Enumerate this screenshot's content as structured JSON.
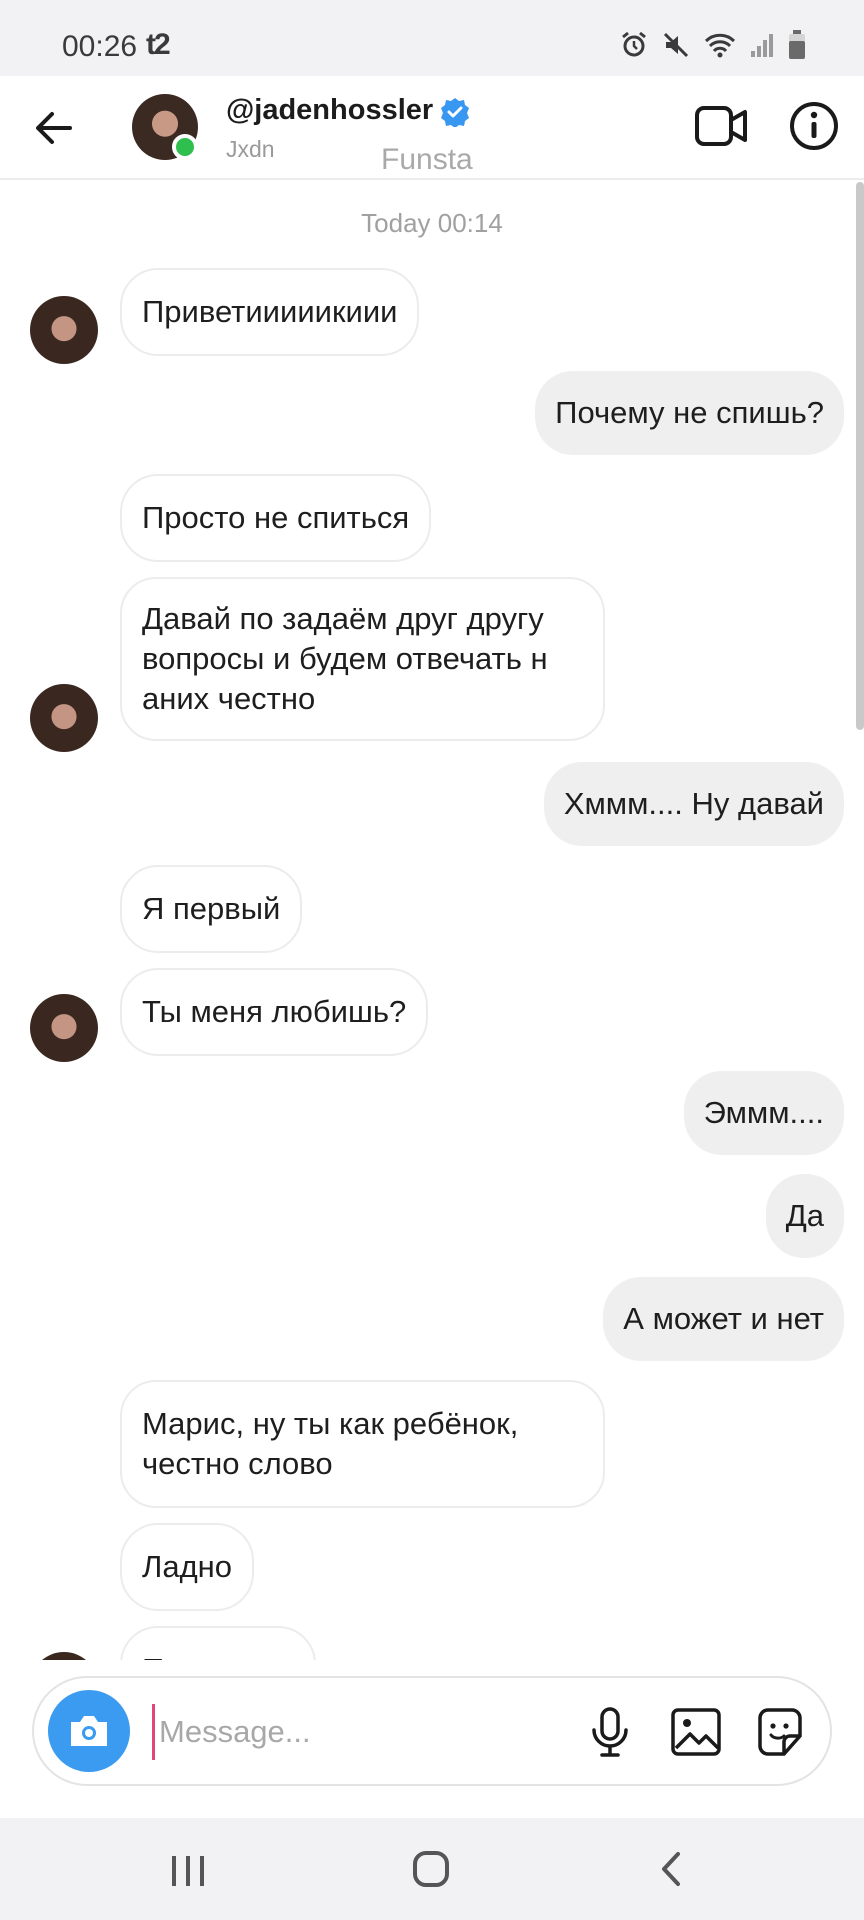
{
  "status_bar": {
    "time": "00:26",
    "carrier": "t2"
  },
  "header": {
    "username": "@jadenhossler",
    "subname": "Jxdn",
    "overlay_text": "Funsta"
  },
  "chat": {
    "timestamp": "Today 00:14",
    "messages": [
      {
        "dir": "in",
        "text": "Приветииииикиии"
      },
      {
        "dir": "out",
        "text": "Почему не спишь?"
      },
      {
        "dir": "in",
        "text": "Просто не спиться"
      },
      {
        "dir": "in",
        "text": "Давай по задаём друг другу вопросы и будем отвечать н аних честно"
      },
      {
        "dir": "out",
        "text": "Хммм.... Ну давай"
      },
      {
        "dir": "in",
        "text": "Я первый"
      },
      {
        "dir": "in",
        "text": "Ты меня любишь?"
      },
      {
        "dir": "out",
        "text": "Эммм...."
      },
      {
        "dir": "out",
        "text": "Да"
      },
      {
        "dir": "out",
        "text": "А может и нет"
      },
      {
        "dir": "in",
        "text": "Марис, ну ты как ребёнок, честно слово"
      },
      {
        "dir": "in",
        "text": "Ладно"
      },
      {
        "dir": "in",
        "text": "П"
      }
    ]
  },
  "composer": {
    "placeholder": "Message..."
  },
  "icons": {
    "back": "arrow-left-icon",
    "video": "video-camera-icon",
    "info": "info-icon",
    "camera": "camera-icon",
    "mic": "microphone-icon",
    "gallery": "image-icon",
    "sticker": "sticker-icon",
    "verified": "verified-badge-icon"
  },
  "colors": {
    "accent_blue": "#3a9bf0",
    "online_green": "#2fbf4f",
    "outgoing_bubble": "#efefef",
    "incoming_border": "#ececec"
  }
}
